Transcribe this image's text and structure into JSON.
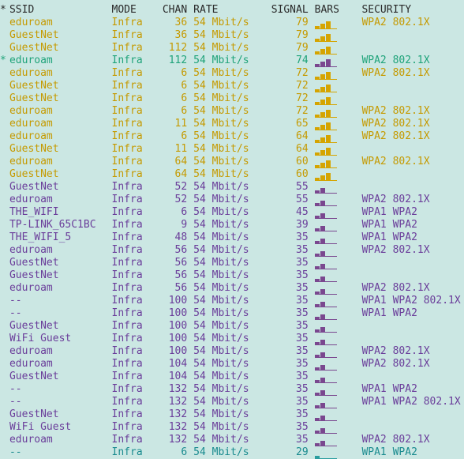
{
  "headers": {
    "star": "*",
    "ssid": "SSID",
    "mode": "MODE",
    "chan": "CHAN",
    "rate": "RATE",
    "signal": "SIGNAL",
    "bars": "BARS",
    "security": "SECURITY"
  },
  "rows": [
    {
      "star": "",
      "ssid": "eduroam",
      "mode": "Infra",
      "chan": "36",
      "rate": "54 Mbit/s",
      "signal": "79",
      "bars": 3,
      "security": "WPA2 802.1X",
      "color": "yellow"
    },
    {
      "star": "",
      "ssid": "GuestNet",
      "mode": "Infra",
      "chan": "36",
      "rate": "54 Mbit/s",
      "signal": "79",
      "bars": 3,
      "security": "",
      "color": "yellow"
    },
    {
      "star": "",
      "ssid": "GuestNet",
      "mode": "Infra",
      "chan": "112",
      "rate": "54 Mbit/s",
      "signal": "79",
      "bars": 3,
      "security": "",
      "color": "yellow"
    },
    {
      "star": "*",
      "ssid": "eduroam",
      "mode": "Infra",
      "chan": "112",
      "rate": "54 Mbit/s",
      "signal": "74",
      "bars": 3,
      "security": "WPA2 802.1X",
      "color": "green"
    },
    {
      "star": "",
      "ssid": "eduroam",
      "mode": "Infra",
      "chan": "6",
      "rate": "54 Mbit/s",
      "signal": "72",
      "bars": 3,
      "security": "WPA2 802.1X",
      "color": "yellow"
    },
    {
      "star": "",
      "ssid": "GuestNet",
      "mode": "Infra",
      "chan": "6",
      "rate": "54 Mbit/s",
      "signal": "72",
      "bars": 3,
      "security": "",
      "color": "yellow"
    },
    {
      "star": "",
      "ssid": "GuestNet",
      "mode": "Infra",
      "chan": "6",
      "rate": "54 Mbit/s",
      "signal": "72",
      "bars": 3,
      "security": "",
      "color": "yellow"
    },
    {
      "star": "",
      "ssid": "eduroam",
      "mode": "Infra",
      "chan": "6",
      "rate": "54 Mbit/s",
      "signal": "72",
      "bars": 3,
      "security": "WPA2 802.1X",
      "color": "yellow"
    },
    {
      "star": "",
      "ssid": "eduroam",
      "mode": "Infra",
      "chan": "11",
      "rate": "54 Mbit/s",
      "signal": "65",
      "bars": 3,
      "security": "WPA2 802.1X",
      "color": "yellow"
    },
    {
      "star": "",
      "ssid": "eduroam",
      "mode": "Infra",
      "chan": "6",
      "rate": "54 Mbit/s",
      "signal": "64",
      "bars": 3,
      "security": "WPA2 802.1X",
      "color": "yellow"
    },
    {
      "star": "",
      "ssid": "GuestNet",
      "mode": "Infra",
      "chan": "11",
      "rate": "54 Mbit/s",
      "signal": "64",
      "bars": 3,
      "security": "",
      "color": "yellow"
    },
    {
      "star": "",
      "ssid": "eduroam",
      "mode": "Infra",
      "chan": "64",
      "rate": "54 Mbit/s",
      "signal": "60",
      "bars": 3,
      "security": "WPA2 802.1X",
      "color": "yellow"
    },
    {
      "star": "",
      "ssid": "GuestNet",
      "mode": "Infra",
      "chan": "64",
      "rate": "54 Mbit/s",
      "signal": "60",
      "bars": 3,
      "security": "",
      "color": "yellow"
    },
    {
      "star": "",
      "ssid": "GuestNet",
      "mode": "Infra",
      "chan": "52",
      "rate": "54 Mbit/s",
      "signal": "55",
      "bars": 2,
      "security": "",
      "color": "purple"
    },
    {
      "star": "",
      "ssid": "eduroam",
      "mode": "Infra",
      "chan": "52",
      "rate": "54 Mbit/s",
      "signal": "55",
      "bars": 2,
      "security": "WPA2 802.1X",
      "color": "purple"
    },
    {
      "star": "",
      "ssid": "THE_WIFI",
      "mode": "Infra",
      "chan": "6",
      "rate": "54 Mbit/s",
      "signal": "45",
      "bars": 2,
      "security": "WPA1 WPA2",
      "color": "purple"
    },
    {
      "star": "",
      "ssid": "TP-LINK_65C1BC",
      "mode": "Infra",
      "chan": "9",
      "rate": "54 Mbit/s",
      "signal": "39",
      "bars": 2,
      "security": "WPA1 WPA2",
      "color": "purple"
    },
    {
      "star": "",
      "ssid": "THE_WIFI_5",
      "mode": "Infra",
      "chan": "48",
      "rate": "54 Mbit/s",
      "signal": "35",
      "bars": 2,
      "security": "WPA1 WPA2",
      "color": "purple"
    },
    {
      "star": "",
      "ssid": "eduroam",
      "mode": "Infra",
      "chan": "56",
      "rate": "54 Mbit/s",
      "signal": "35",
      "bars": 2,
      "security": "WPA2 802.1X",
      "color": "purple"
    },
    {
      "star": "",
      "ssid": "GuestNet",
      "mode": "Infra",
      "chan": "56",
      "rate": "54 Mbit/s",
      "signal": "35",
      "bars": 2,
      "security": "",
      "color": "purple"
    },
    {
      "star": "",
      "ssid": "GuestNet",
      "mode": "Infra",
      "chan": "56",
      "rate": "54 Mbit/s",
      "signal": "35",
      "bars": 2,
      "security": "",
      "color": "purple"
    },
    {
      "star": "",
      "ssid": "eduroam",
      "mode": "Infra",
      "chan": "56",
      "rate": "54 Mbit/s",
      "signal": "35",
      "bars": 2,
      "security": "WPA2 802.1X",
      "color": "purple"
    },
    {
      "star": "",
      "ssid": "--",
      "mode": "Infra",
      "chan": "100",
      "rate": "54 Mbit/s",
      "signal": "35",
      "bars": 2,
      "security": "WPA1 WPA2 802.1X",
      "color": "purple"
    },
    {
      "star": "",
      "ssid": "--",
      "mode": "Infra",
      "chan": "100",
      "rate": "54 Mbit/s",
      "signal": "35",
      "bars": 2,
      "security": "WPA1 WPA2",
      "color": "purple"
    },
    {
      "star": "",
      "ssid": "GuestNet",
      "mode": "Infra",
      "chan": "100",
      "rate": "54 Mbit/s",
      "signal": "35",
      "bars": 2,
      "security": "",
      "color": "purple"
    },
    {
      "star": "",
      "ssid": "WiFi Guest",
      "mode": "Infra",
      "chan": "100",
      "rate": "54 Mbit/s",
      "signal": "35",
      "bars": 2,
      "security": "",
      "color": "purple"
    },
    {
      "star": "",
      "ssid": "eduroam",
      "mode": "Infra",
      "chan": "100",
      "rate": "54 Mbit/s",
      "signal": "35",
      "bars": 2,
      "security": "WPA2 802.1X",
      "color": "purple"
    },
    {
      "star": "",
      "ssid": "eduroam",
      "mode": "Infra",
      "chan": "104",
      "rate": "54 Mbit/s",
      "signal": "35",
      "bars": 2,
      "security": "WPA2 802.1X",
      "color": "purple"
    },
    {
      "star": "",
      "ssid": "GuestNet",
      "mode": "Infra",
      "chan": "104",
      "rate": "54 Mbit/s",
      "signal": "35",
      "bars": 2,
      "security": "",
      "color": "purple"
    },
    {
      "star": "",
      "ssid": "--",
      "mode": "Infra",
      "chan": "132",
      "rate": "54 Mbit/s",
      "signal": "35",
      "bars": 2,
      "security": "WPA1 WPA2",
      "color": "purple"
    },
    {
      "star": "",
      "ssid": "--",
      "mode": "Infra",
      "chan": "132",
      "rate": "54 Mbit/s",
      "signal": "35",
      "bars": 2,
      "security": "WPA1 WPA2 802.1X",
      "color": "purple"
    },
    {
      "star": "",
      "ssid": "GuestNet",
      "mode": "Infra",
      "chan": "132",
      "rate": "54 Mbit/s",
      "signal": "35",
      "bars": 2,
      "security": "",
      "color": "purple"
    },
    {
      "star": "",
      "ssid": "WiFi Guest",
      "mode": "Infra",
      "chan": "132",
      "rate": "54 Mbit/s",
      "signal": "35",
      "bars": 2,
      "security": "",
      "color": "purple"
    },
    {
      "star": "",
      "ssid": "eduroam",
      "mode": "Infra",
      "chan": "132",
      "rate": "54 Mbit/s",
      "signal": "35",
      "bars": 2,
      "security": "WPA2 802.1X",
      "color": "purple"
    },
    {
      "star": "",
      "ssid": "--",
      "mode": "Infra",
      "chan": "6",
      "rate": "54 Mbit/s",
      "signal": "29",
      "bars": 1,
      "security": "WPA1 WPA2",
      "color": "teal"
    }
  ]
}
